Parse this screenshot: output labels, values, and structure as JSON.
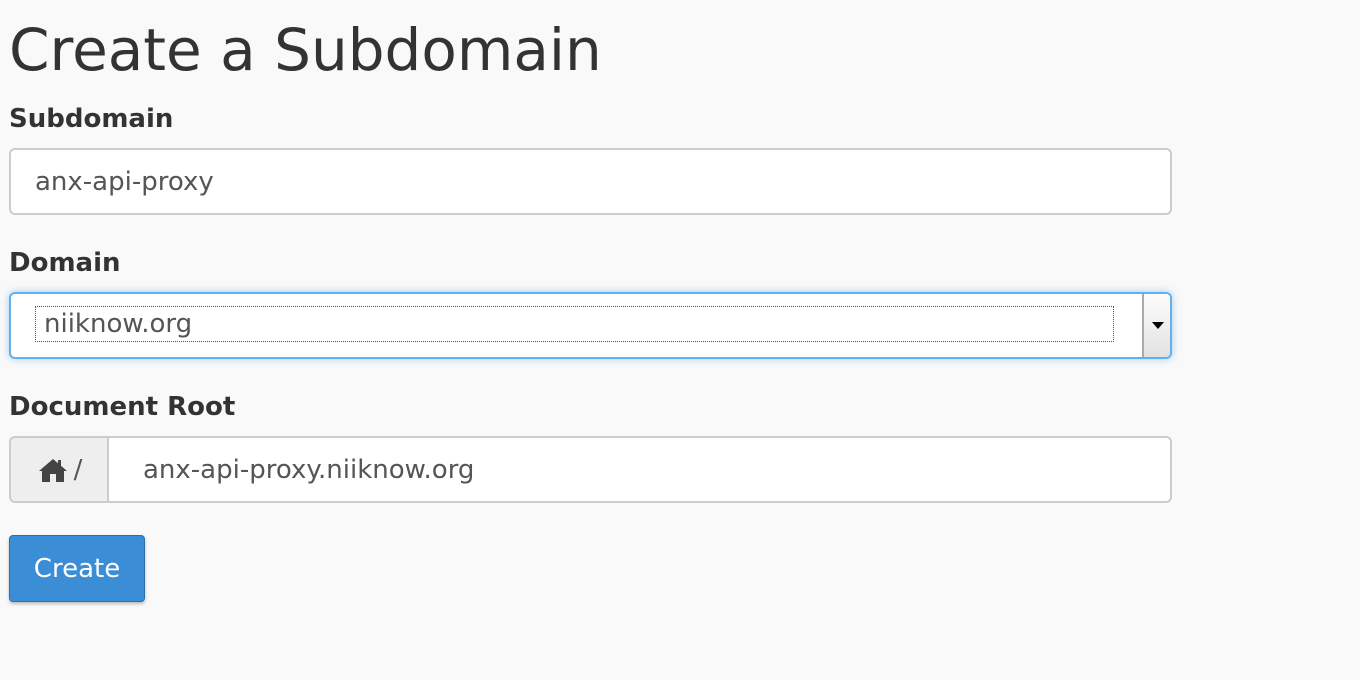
{
  "page": {
    "title": "Create a Subdomain"
  },
  "form": {
    "subdomain": {
      "label": "Subdomain",
      "value": "anx-api-proxy"
    },
    "domain": {
      "label": "Domain",
      "selected": "niiknow.org"
    },
    "document_root": {
      "label": "Document Root",
      "prefix_icon": "home-icon",
      "prefix_text": "/",
      "value": "anx-api-proxy.niiknow.org"
    },
    "submit_label": "Create"
  },
  "colors": {
    "background": "#f9f9f9",
    "primary_button": "#3b8dd6",
    "focus_ring": "#66afe9"
  }
}
